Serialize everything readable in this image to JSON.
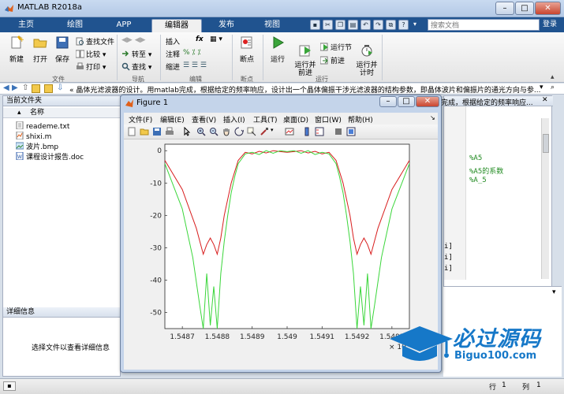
{
  "window": {
    "title": "MATLAB R2018a"
  },
  "tabs": [
    {
      "label": "主页"
    },
    {
      "label": "绘图"
    },
    {
      "label": "APP"
    },
    {
      "label": "编辑器"
    },
    {
      "label": "发布"
    },
    {
      "label": "视图"
    }
  ],
  "search": {
    "placeholder": "搜索文档"
  },
  "collapse_label": "登录",
  "ribbon": {
    "file": {
      "group": "文件",
      "new": "新建",
      "open": "打开",
      "save": "保存",
      "find_files": "查找文件",
      "compare": "比较",
      "print": "打印"
    },
    "nav": {
      "group": "导航",
      "goto": "转至",
      "find": "查找"
    },
    "edit": {
      "group": "编辑",
      "insert": "插入",
      "comment": "注释",
      "indent": "缩进",
      "fx": "fx"
    },
    "breakpoint": {
      "group": "断点",
      "label": "断点"
    },
    "run": {
      "group": "运行",
      "run": "运行",
      "run_advance": "运行并\n前进",
      "run_section": "运行节",
      "advance": "前进",
      "run_time": "运行并\n计时"
    }
  },
  "address": {
    "path": "« 晶体光滤波器的设计。用matlab完成，根据给定的频率响应，设计出一个晶体偏振干涉光滤波器的结构参数，即晶体波片和偏振片的通光方向与参..."
  },
  "address_tail": "完成，根据给定的频率响应...",
  "left_panel": {
    "title": "当前文件夹",
    "col_name": "名称",
    "files": [
      {
        "name": "reademe.txt",
        "icon": "text-file-icon"
      },
      {
        "name": "shixi.m",
        "icon": "m-file-icon"
      },
      {
        "name": "波片.bmp",
        "icon": "image-file-icon"
      },
      {
        "name": "课程设计报告.doc",
        "icon": "doc-file-icon"
      }
    ],
    "details_title": "详细信息",
    "details_hint": "选择文件以查看详细信息"
  },
  "editor": {
    "comments": [
      "%A5",
      "%A5的系数",
      "%A_5"
    ],
    "brackets": [
      "i]",
      "i]",
      "i]"
    ]
  },
  "status": {
    "row_label": "行",
    "row": "1",
    "col_label": "列",
    "col": "1"
  },
  "figure": {
    "title": "Figure 1",
    "menu": [
      "文件(F)",
      "编辑(E)",
      "查看(V)",
      "插入(I)",
      "工具(T)",
      "桌面(D)",
      "窗口(W)",
      "帮助(H)"
    ]
  },
  "chart_data": {
    "type": "line",
    "title": "",
    "xlabel": "",
    "ylabel": "",
    "x_exponent_label": "× 10",
    "x_exponent_power": "-6",
    "xlim": [
      1.54865,
      1.54935
    ],
    "ylim": [
      -55,
      2
    ],
    "xticks": [
      1.5487,
      1.5488,
      1.5489,
      1.549,
      1.5491,
      1.5492,
      1.5493
    ],
    "xticklabels": [
      "1.5487",
      "1.5488",
      "1.5489",
      "1.549",
      "1.5491",
      "1.5492",
      "1.5493"
    ],
    "yticks": [
      0,
      -10,
      -20,
      -30,
      -40,
      -50
    ],
    "yticklabels": [
      "0",
      "-10",
      "-20",
      "-30",
      "-40",
      "-50"
    ],
    "grid": false,
    "series": [
      {
        "color": "#d81e1e",
        "x": [
          1.54865,
          1.5487,
          1.54874,
          1.54876,
          1.54877,
          1.54878,
          1.54879,
          1.5488,
          1.54881,
          1.54882,
          1.54884,
          1.54886,
          1.54888,
          1.5489,
          1.54892,
          1.54894,
          1.54896,
          1.54898,
          1.549,
          1.54902,
          1.54904,
          1.54906,
          1.54908,
          1.5491,
          1.54912,
          1.54914,
          1.54916,
          1.54918,
          1.54919,
          1.5492,
          1.54921,
          1.54922,
          1.54923,
          1.54924,
          1.54926,
          1.5493,
          1.54935
        ],
        "y": [
          -3,
          -12,
          -24,
          -32,
          -29,
          -27,
          -29,
          -32,
          -27,
          -20,
          -10,
          -3,
          -0.5,
          -1,
          -0.2,
          -0.7,
          0,
          -0.3,
          -0.5,
          -0.3,
          0,
          -0.7,
          -0.2,
          -1,
          -0.5,
          -3,
          -10,
          -20,
          -27,
          -32,
          -29,
          -27,
          -29,
          -32,
          -24,
          -12,
          -3
        ]
      },
      {
        "color": "#3ad63a",
        "x": [
          1.54865,
          1.5487,
          1.54873,
          1.54875,
          1.54876,
          1.54877,
          1.54878,
          1.54879,
          1.5488,
          1.54881,
          1.54882,
          1.54883,
          1.54884,
          1.54885,
          1.54886,
          1.54888,
          1.5489,
          1.54892,
          1.54894,
          1.54896,
          1.54898,
          1.549,
          1.54902,
          1.54904,
          1.54906,
          1.54908,
          1.5491,
          1.54912,
          1.54914,
          1.54915,
          1.54916,
          1.54917,
          1.54918,
          1.54919,
          1.5492,
          1.54921,
          1.54922,
          1.54923,
          1.54924,
          1.54925,
          1.54927,
          1.5493,
          1.54935
        ],
        "y": [
          -4,
          -18,
          -33,
          -48,
          -56,
          -38,
          -54,
          -42,
          -56,
          -38,
          -28,
          -20,
          -13,
          -8,
          -4,
          -1,
          -0.5,
          -1.2,
          0,
          -0.8,
          0,
          -0.3,
          0,
          -0.8,
          0,
          -1.2,
          -0.5,
          -1,
          -4,
          -8,
          -13,
          -20,
          -28,
          -38,
          -56,
          -42,
          -54,
          -38,
          -56,
          -48,
          -33,
          -18,
          -4
        ]
      }
    ]
  },
  "colors": {
    "ribbon_bg": "#20538f",
    "accent": "#1678c8"
  },
  "watermark": {
    "big": "必过源码",
    "url": "Biguo100.com"
  }
}
